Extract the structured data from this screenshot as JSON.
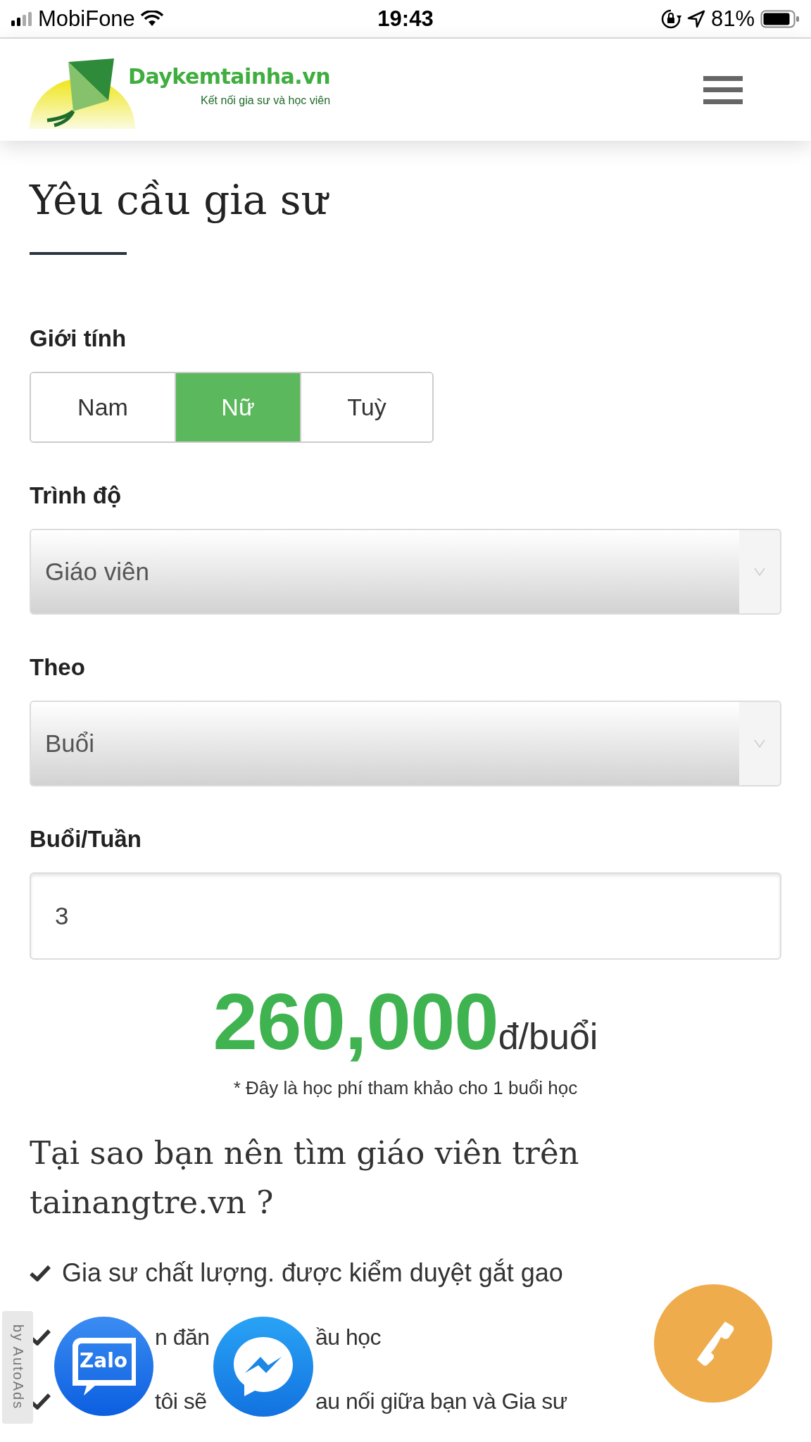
{
  "status_bar": {
    "carrier": "MobiFone",
    "time": "19:43",
    "battery_text": "81%"
  },
  "header": {
    "logo_title": "Daykemtainha.vn",
    "logo_tagline": "Kết nối gia sư và học viên"
  },
  "title": "Yêu cầu gia sư",
  "gender": {
    "label": "Giới tính",
    "options": [
      {
        "label": "Nam",
        "selected": false
      },
      {
        "label": "Nữ",
        "selected": true
      },
      {
        "label": "Tuỳ",
        "selected": false
      }
    ]
  },
  "level_select": {
    "label": "Trình độ",
    "value": "Giáo viên"
  },
  "mode_select": {
    "label": "Theo",
    "value": "Buổi"
  },
  "sessions": {
    "label": "Buổi/Tuần",
    "value": "3"
  },
  "price": {
    "amount": "260,000",
    "unit": "đ/buổi",
    "note": "* Đây là học phí tham khảo cho 1 buổi học"
  },
  "why": {
    "heading": "Tại sao bạn nên tìm giáo viên trên tainangtre.vn ?",
    "points": [
      {
        "parts": [
          "Gia sư chất lượng. được kiểm duyệt gắt gao"
        ]
      },
      {
        "parts": [
          "n đăn",
          "ầu học"
        ]
      },
      {
        "parts": [
          "tôi sẽ",
          "au nối giữa bạn và Gia sư"
        ]
      }
    ]
  },
  "floating": {
    "autoads": "by AutoAds",
    "zalo": "Zalo"
  }
}
